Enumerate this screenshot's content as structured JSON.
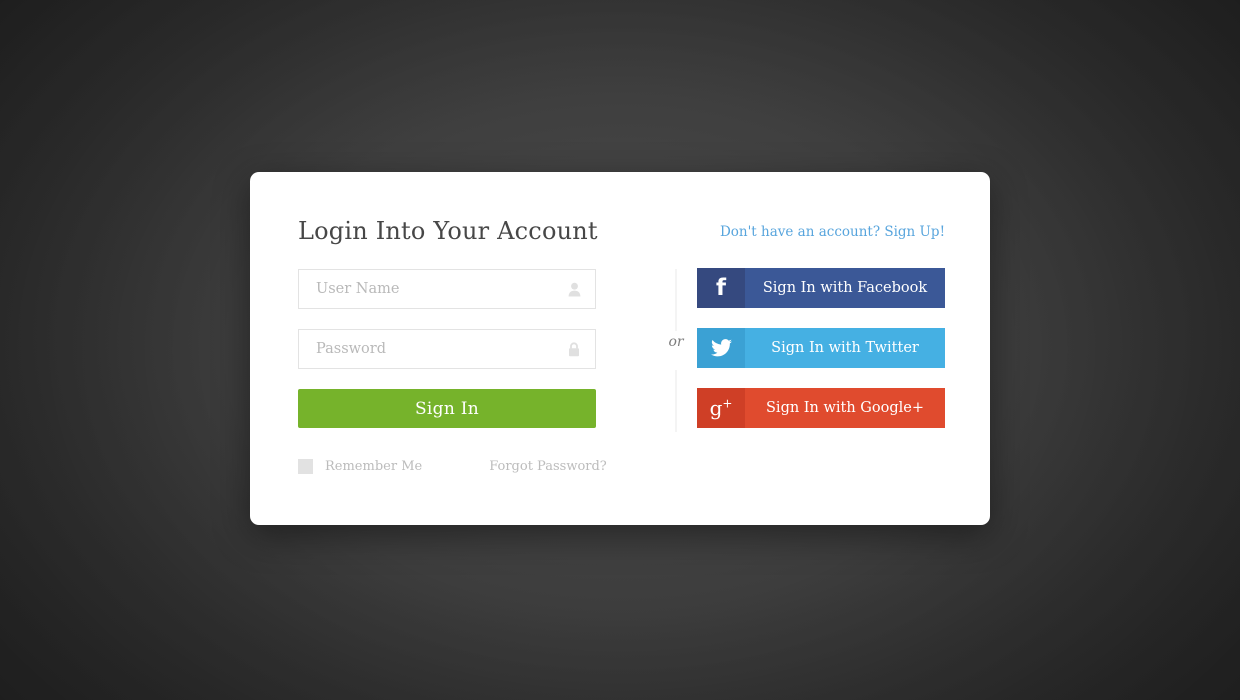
{
  "theme": {
    "background_color": "#3c3c3c",
    "card_color": "#ffffff",
    "accent_green": "#76b32b",
    "link_blue": "#58a5dd",
    "muted_gray": "#bcbcbc",
    "facebook_color": "#3b5897",
    "twitter_color": "#45b0e3",
    "googleplus_color": "#e04b2e"
  },
  "card": {
    "title": "Login Into Your Account",
    "signup_link": "Don't have an account? Sign Up!"
  },
  "form": {
    "username": {
      "value": "",
      "placeholder": "User Name",
      "icon": "user-icon"
    },
    "password": {
      "value": "",
      "placeholder": "Password",
      "icon": "lock-icon"
    },
    "submit_label": "Sign In",
    "remember_label": "Remember Me",
    "remember_checked": false,
    "forgot_label": "Forgot Password?"
  },
  "divider": {
    "label": "or"
  },
  "social": {
    "buttons": [
      {
        "label": "Sign In with Facebook",
        "icon": "facebook-icon",
        "glyph": "f",
        "color": "#3b5897"
      },
      {
        "label": "Sign In with Twitter",
        "icon": "twitter-icon",
        "glyph": "",
        "color": "#45b0e3"
      },
      {
        "label": "Sign In with Google+",
        "icon": "googleplus-icon",
        "glyph": "g+",
        "color": "#e04b2e"
      }
    ]
  }
}
